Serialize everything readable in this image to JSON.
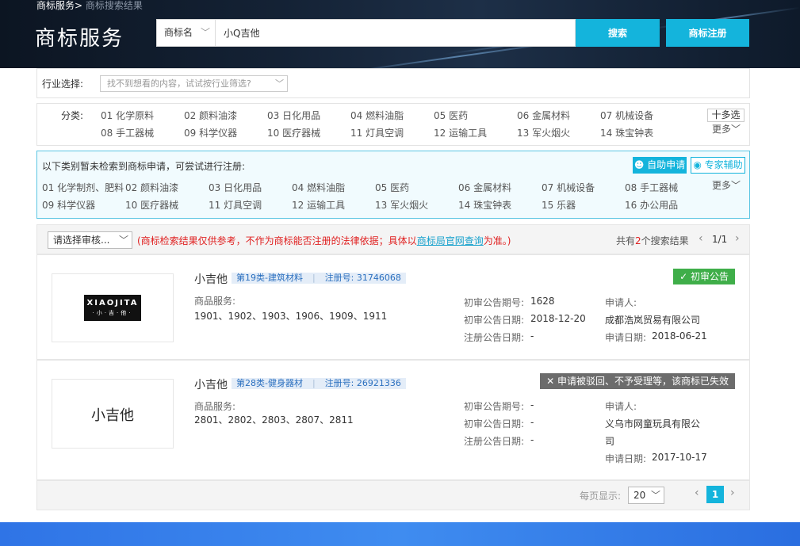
{
  "header": {
    "breadcrumb_home": "商标服务>",
    "breadcrumb_current": "商标搜索结果",
    "brand": "商标服务",
    "search_type": "商标名",
    "search_value": "小Q吉他",
    "search_button": "搜索",
    "register_button": "商标注册"
  },
  "industry": {
    "label": "行业选择:",
    "placeholder": "找不到想看的内容，试试按行业筛选?"
  },
  "categories": {
    "label": "分类:",
    "items": [
      "01 化学原料",
      "02 颜料油漆",
      "03 日化用品",
      "04 燃料油脂",
      "05 医药",
      "06 金属材料",
      "07 机械设备",
      "08 手工器械",
      "09 科学仪器",
      "10 医疗器械",
      "11 灯具空调",
      "12 运输工具",
      "13 军火烟火",
      "14 珠宝钟表"
    ],
    "multi_select": "十多选",
    "more": "更多"
  },
  "suggest": {
    "title": "以下类别暂未检索到商标申请，可尝试进行注册:",
    "self_apply": "自助申请",
    "expert_help": "专家辅助",
    "items": [
      "01 化学制剂、肥料",
      "02 颜料油漆",
      "03 日化用品",
      "04 燃料油脂",
      "05 医药",
      "06 金属材料",
      "07 机械设备",
      "08 手工器械",
      "09 科学仪器",
      "10 医疗器械",
      "11 灯具空调",
      "12 运输工具",
      "13 军火烟火",
      "14 珠宝钟表",
      "15 乐器",
      "16 办公用品"
    ],
    "more": "更多"
  },
  "results_bar": {
    "status_select": "请选择审核...",
    "notice_prefix": "(商标检索结果仅供参考，不作为商标能否注册的法律依据；具体以",
    "notice_link": "商标局官网查询",
    "notice_suffix": "为准。)",
    "total_prefix": "共有",
    "total_count": "2",
    "total_suffix": "个搜索结果",
    "page_info": "1/1",
    "prev_icon": "‹",
    "next_icon": "›"
  },
  "results": [
    {
      "name": "小吉他",
      "category": "第19类-建筑材料",
      "reg_label": "注册号:",
      "reg_no": "31746068",
      "status": "初审公告",
      "status_color": "#3fae49",
      "logo_en": "XIAOJITA",
      "logo_cn": "·小·吉·他·",
      "goods_label": "商品服务:",
      "goods": "1901、1902、1903、1906、1909、1911",
      "prelim_no_label": "初审公告期号:",
      "prelim_no": "1628",
      "prelim_date_label": "初审公告日期:",
      "prelim_date": "2018-12-20",
      "reg_date_label": "注册公告日期:",
      "reg_date": "-",
      "applicant_label": "申请人:",
      "applicant": "成都浩岚贸易有限公司",
      "apply_date_label": "申请日期:",
      "apply_date": "2018-06-21"
    },
    {
      "name": "小吉他",
      "category": "第28类-健身器材",
      "reg_label": "注册号:",
      "reg_no": "26921336",
      "status": "申请被驳回、不予受理等，该商标已失效",
      "status_color": "#6c6c6c",
      "logo_text": "小吉他",
      "goods_label": "商品服务:",
      "goods": "2801、2802、2803、2807、2811",
      "prelim_no_label": "初审公告期号:",
      "prelim_no": "-",
      "prelim_date_label": "初审公告日期:",
      "prelim_date": "-",
      "reg_date_label": "注册公告日期:",
      "reg_date": "-",
      "applicant_label": "申请人:",
      "applicant_line1": "义乌市网童玩具有限公",
      "applicant_line2": "司",
      "apply_date_label": "申请日期:",
      "apply_date": "2017-10-17"
    }
  ],
  "pager": {
    "per_page_label": "每页显示:",
    "per_page": "20",
    "current_page": "1",
    "prev_icon": "‹",
    "next_icon": "›"
  },
  "icons": {
    "chevron": "﹀",
    "check": "✓",
    "close": "✕"
  }
}
